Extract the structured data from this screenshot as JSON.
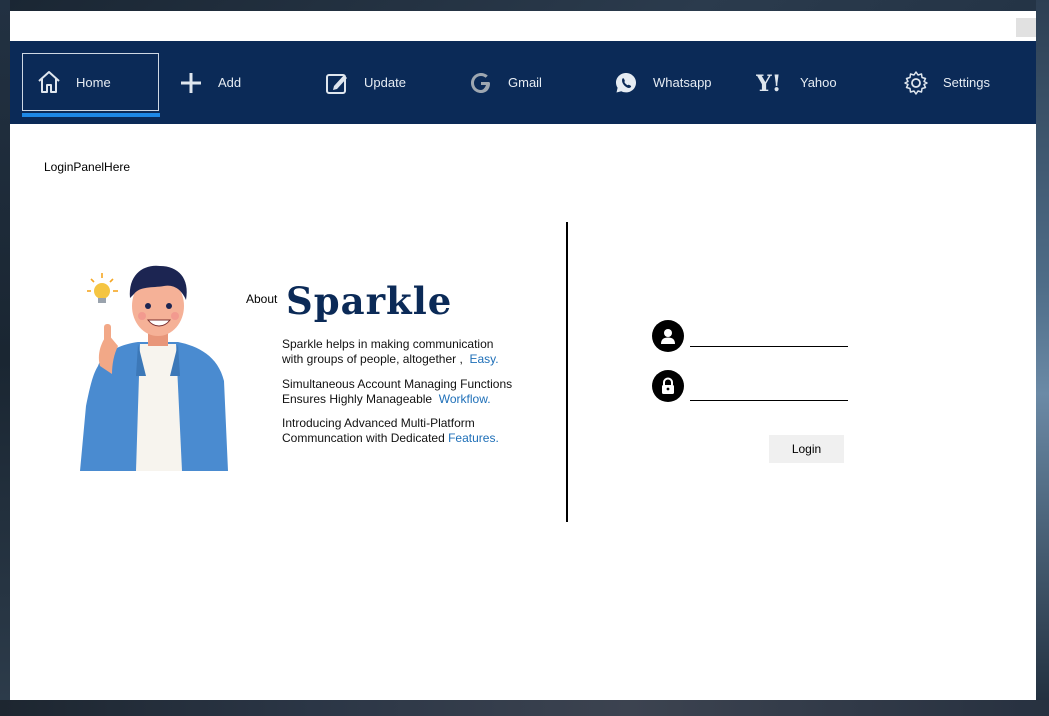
{
  "nav": {
    "items": [
      {
        "label": "Home",
        "icon": "home-icon"
      },
      {
        "label": "Add",
        "icon": "plus-icon"
      },
      {
        "label": "Update",
        "icon": "edit-icon"
      },
      {
        "label": "Gmail",
        "icon": "google-icon"
      },
      {
        "label": "Whatsapp",
        "icon": "whatsapp-icon"
      },
      {
        "label": "Yahoo",
        "icon": "yahoo-icon"
      },
      {
        "label": "Settings",
        "icon": "gear-icon"
      }
    ],
    "active": "Home",
    "background": "#0b2a57",
    "active_indicator": "#1e88e5"
  },
  "panel_label": "LoginPanelHere",
  "about": {
    "prefix": "About",
    "brand": "Sparkle",
    "paragraphs": [
      {
        "line1": "Sparkle helps in making communication",
        "line2": "with groups of people, altogether ,",
        "highlight": "Easy."
      },
      {
        "line1": "Simultaneous Account Managing Functions",
        "line2": "Ensures Highly Manageable",
        "highlight": "Workflow."
      },
      {
        "line1": "Introducing Advanced Multi-Platform",
        "line2": "Communcation with Dedicated",
        "highlight": "Features."
      }
    ],
    "highlight_color": "#1e6fb8"
  },
  "login": {
    "username_value": "",
    "password_value": "",
    "button_label": "Login"
  }
}
